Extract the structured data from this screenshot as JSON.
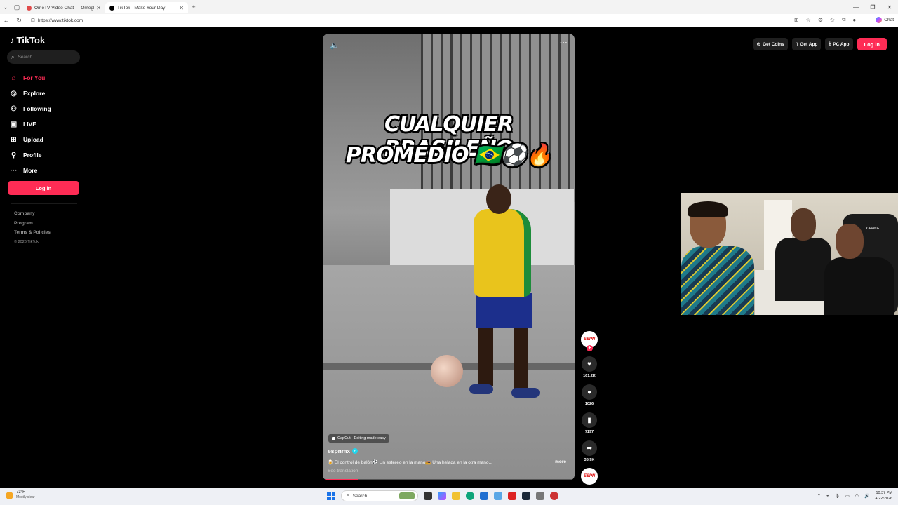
{
  "browser": {
    "tabs": [
      {
        "label": "OmeTV Video Chat — Omegl",
        "active": false
      },
      {
        "label": "TikTok - Make Your Day",
        "active": true
      }
    ],
    "url": "https://www.tiktok.com",
    "chat_label": "Chat"
  },
  "sidebar": {
    "logo_text": "TikTok",
    "search_placeholder": "Search",
    "items": [
      {
        "label": "For You",
        "icon": "home-icon",
        "active": true
      },
      {
        "label": "Explore",
        "icon": "compass-icon"
      },
      {
        "label": "Following",
        "icon": "following-icon"
      },
      {
        "label": "LIVE",
        "icon": "live-icon"
      },
      {
        "label": "Upload",
        "icon": "upload-icon"
      },
      {
        "label": "Profile",
        "icon": "profile-icon"
      },
      {
        "label": "More",
        "icon": "more-icon"
      }
    ],
    "login_label": "Log in",
    "footer": {
      "company": "Company",
      "program": "Program",
      "terms": "Terms & Policies",
      "copyright": "© 2026 TikTok"
    }
  },
  "header": {
    "get_coins": "Get Coins",
    "get_app": "Get App",
    "pc_app": "PC App",
    "login": "Log in"
  },
  "video": {
    "caption_line1": "CUALQUIER BRASILEÑO",
    "caption_line2": "PROMEDIO 🇧🇷⚽🔥",
    "capcut_label": "CapCut · Editing made easy",
    "author": "espnmx",
    "description": "🍺 El control de balón⚽ Un estéreo en la mano📻 Una helada en la otra mano...",
    "more": "more",
    "see_translation": "See translation",
    "progress": 0.14
  },
  "actions": {
    "avatar_text": "ESPN",
    "likes": "161.2K",
    "comments": "1026",
    "saves": "7197",
    "shares": "35.9K",
    "music_text": "ESPN"
  },
  "webcam": {
    "chair_brand": "OFFICE"
  },
  "taskbar": {
    "temp": "73°F",
    "weather": "Mostly clear",
    "search_placeholder": "Search",
    "time": "10:37 PM",
    "date": "4/22/2026"
  },
  "colors": {
    "accent": "#fe2c55",
    "verified": "#20d5ec"
  }
}
